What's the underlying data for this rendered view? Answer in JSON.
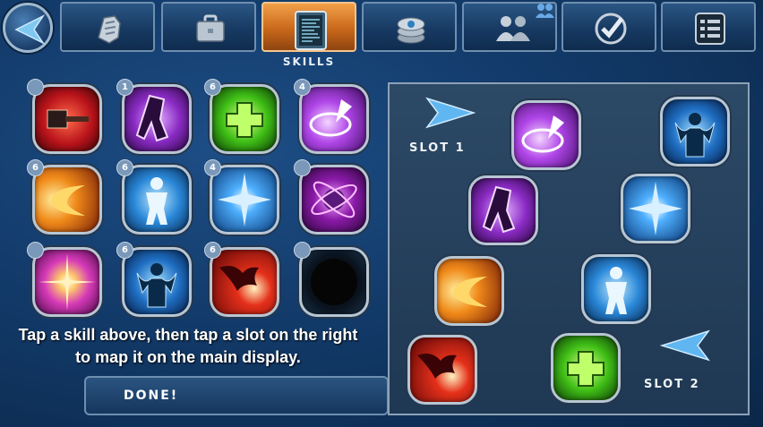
{
  "nav": {
    "back_icon": "back-arrow-icon",
    "tabs": [
      {
        "name": "tab-armor",
        "icon": "armor-icon"
      },
      {
        "name": "tab-inventory",
        "icon": "briefcase-icon"
      },
      {
        "name": "tab-skills",
        "icon": "skills-terminal-icon",
        "label": "Skills",
        "active": true
      },
      {
        "name": "tab-credits",
        "icon": "coins-icon"
      },
      {
        "name": "tab-social",
        "icon": "people-icon"
      },
      {
        "name": "tab-missions",
        "icon": "checkmark-icon"
      },
      {
        "name": "tab-menu",
        "icon": "list-icon"
      }
    ],
    "active_label": "SKILLS"
  },
  "skills": [
    {
      "icon": "hammer-skill-icon",
      "badge": ""
    },
    {
      "icon": "purple-stomp-skill-icon",
      "badge": "1"
    },
    {
      "icon": "green-heal-skill-icon",
      "badge": "6"
    },
    {
      "icon": "purple-vortex-skill-icon",
      "badge": "4"
    },
    {
      "icon": "fire-dash-skill-icon",
      "badge": "6"
    },
    {
      "icon": "blue-hero-skill-icon",
      "badge": "6"
    },
    {
      "icon": "blue-burst-skill-icon",
      "badge": "4"
    },
    {
      "icon": "purple-orbit-skill-icon",
      "badge": ""
    },
    {
      "icon": "starburst-skill-icon",
      "badge": ""
    },
    {
      "icon": "blue-flex-skill-icon",
      "badge": "6"
    },
    {
      "icon": "red-dragon-skill-icon",
      "badge": "6"
    },
    {
      "icon": "locked-skill-icon",
      "badge": ""
    }
  ],
  "instructions": {
    "line1": "Tap a skill above, then tap a slot on the right",
    "line2": "to map it on the main display."
  },
  "done_label": "DONE!",
  "slots": {
    "slot1_label": "SLOT 1",
    "slot2_label": "SLOT 2"
  },
  "colors": {
    "accent": "#e07f2a",
    "panel": "#26405c",
    "background": "#143f6e"
  }
}
